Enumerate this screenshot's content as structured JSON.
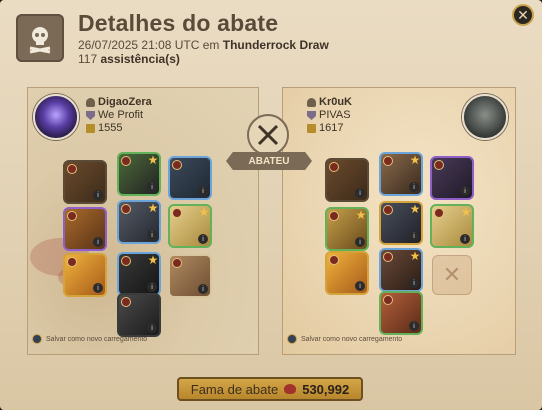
{
  "header": {
    "title": "Detalhes do abate",
    "timestamp": "26/07/2025 21:08 UTC em",
    "location": "Thunderrock Draw",
    "assists_count": "117",
    "assists_label": "assistência(s)"
  },
  "center": {
    "killed_label": "ABATEU"
  },
  "killer": {
    "name": "DigaoZera",
    "guild": "We Profit",
    "item_power": "1555",
    "save_loadout": "Salvar como novo carregamento"
  },
  "victim": {
    "name": "Kr0uK",
    "guild": "PIVAS",
    "item_power": "1617",
    "save_loadout": "Salvar como novo carregamento"
  },
  "footer": {
    "fame_label": "Fama de abate",
    "fame_value": "530,992"
  },
  "colors": {
    "quality_blue": "#6ba4d8",
    "quality_purple": "#8f5fc8",
    "quality_green": "#63b25a",
    "quality_gold": "#d4a43a",
    "quality_gray": "#8a8a8a"
  }
}
